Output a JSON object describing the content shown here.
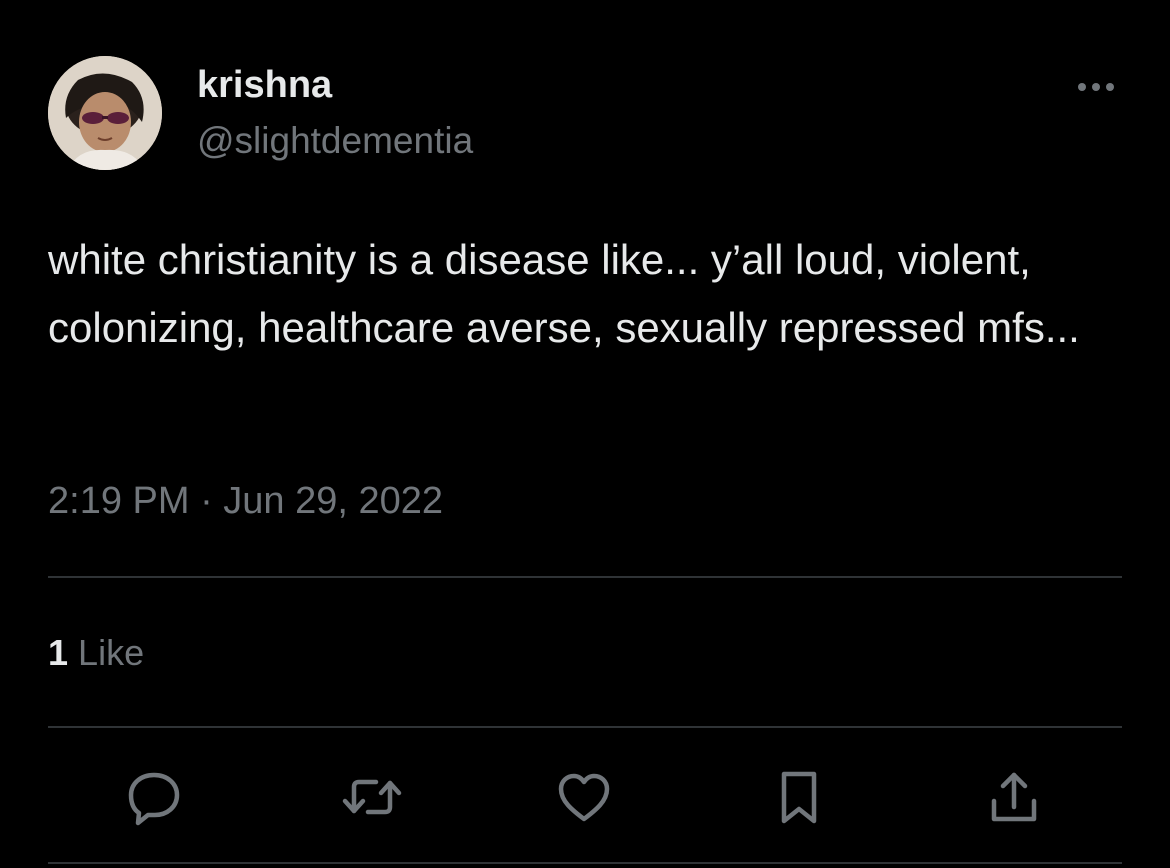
{
  "author": {
    "display_name": "krishna",
    "handle": "@slightdementia",
    "avatar_icon": "profile-photo"
  },
  "tweet": {
    "text": "white christianity is a disease like... y’all loud, violent, colonizing, healthcare averse, sexually repressed mfs...",
    "timestamp": "2:19 PM · Jun 29, 2022"
  },
  "stats": {
    "likes_count": "1",
    "likes_label": "Like"
  },
  "actions": [
    {
      "name": "reply",
      "icon": "speech-bubble-icon"
    },
    {
      "name": "retweet",
      "icon": "retweet-arrows-icon"
    },
    {
      "name": "like",
      "icon": "heart-icon"
    },
    {
      "name": "bookmark",
      "icon": "bookmark-icon"
    },
    {
      "name": "share",
      "icon": "share-upload-icon"
    }
  ],
  "colors": {
    "background": "#000000",
    "primary_text": "#e7e9ea",
    "secondary_text": "#71767b",
    "divider": "#2f3336"
  }
}
